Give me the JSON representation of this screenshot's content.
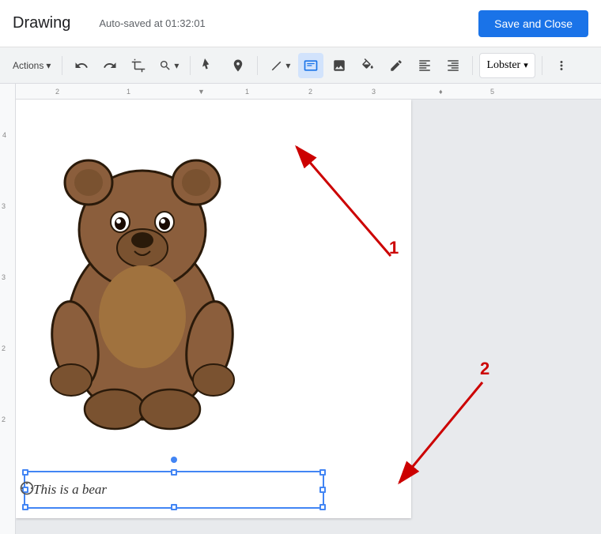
{
  "header": {
    "title": "Drawing",
    "autosave": "Auto-saved at 01:32:01",
    "save_close_label": "Save and Close"
  },
  "toolbar": {
    "actions_label": "Actions",
    "actions_arrow": "▾",
    "font_name": "Lobster",
    "font_arrow": "▾",
    "undo_icon": "↩",
    "redo_icon": "↪",
    "zoom_icon": "⊕",
    "zoom_arrow": "▾",
    "select_icon": "▶",
    "search_icon": "◎",
    "line_icon": "╱",
    "line_arrow": "▾",
    "textbox_icon": "⊡",
    "image_icon": "⬜",
    "paint_icon": "⬦",
    "pencil_icon": "✏",
    "align_icon": "≡",
    "more_icon": "⋮",
    "crop_rotate_icon": "⟲"
  },
  "canvas": {
    "text_box_content": "This is a bear"
  },
  "annotations": {
    "num1": "1",
    "num2": "2"
  }
}
